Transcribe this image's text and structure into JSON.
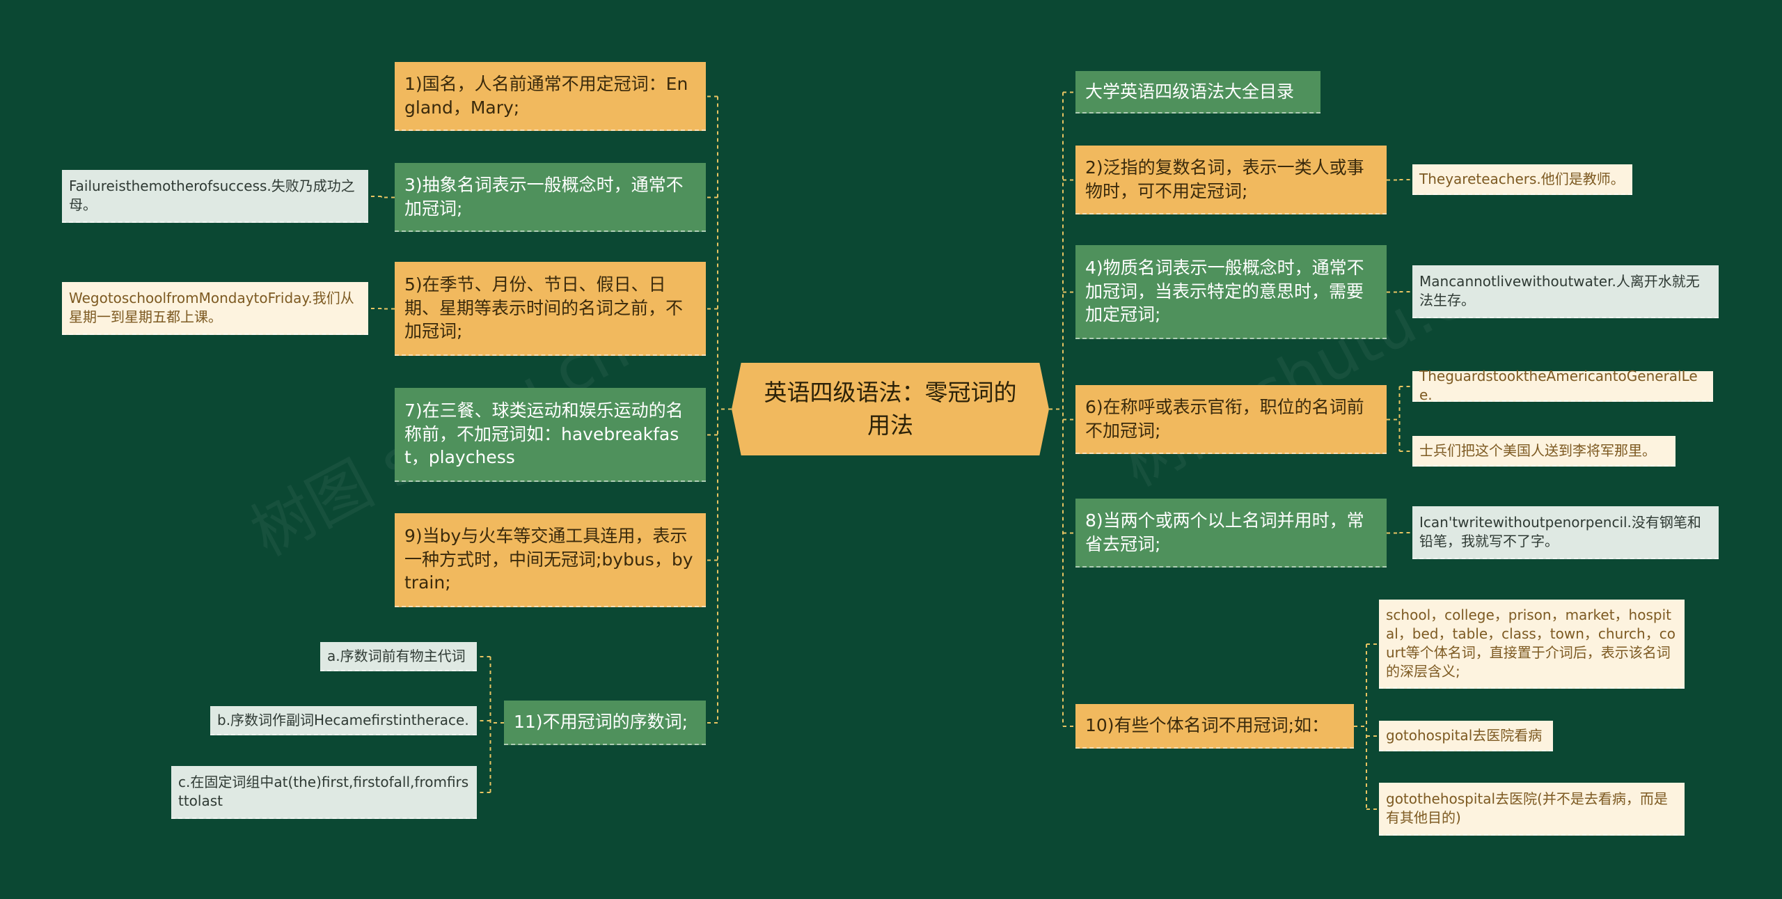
{
  "root": {
    "label": "英语四级语法：零冠词的用法"
  },
  "left_branches": [
    {
      "id": "l1",
      "label": "1)国名，人名前通常不用定冠词：England，Mary;",
      "color": "orange",
      "children": []
    },
    {
      "id": "l3",
      "label": "3)抽象名词表示一般概念时，通常不加冠词;",
      "color": "green",
      "children": [
        {
          "id": "l3a",
          "label": "Failureisthemotherofsuccess.失败乃成功之母。",
          "color": "mint"
        }
      ]
    },
    {
      "id": "l5",
      "label": "5)在季节、月份、节日、假日、日期、星期等表示时间的名词之前，不加冠词;",
      "color": "orange",
      "children": [
        {
          "id": "l5a",
          "label": "WegotoschoolfromMondaytoFriday.我们从星期一到星期五都上课。",
          "color": "cream"
        }
      ]
    },
    {
      "id": "l7",
      "label": "7)在三餐、球类运动和娱乐运动的名称前，不加冠词如：havebreakfast，playchess",
      "color": "green",
      "children": []
    },
    {
      "id": "l9",
      "label": "9)当by与火车等交通工具连用，表示一种方式时，中间无冠词;bybus，bytrain;",
      "color": "orange",
      "children": []
    },
    {
      "id": "l11",
      "label": "11)不用冠词的序数词;",
      "color": "green",
      "children": [
        {
          "id": "l11a",
          "label": "a.序数词前有物主代词",
          "color": "mint"
        },
        {
          "id": "l11b",
          "label": "b.序数词作副词Hecamefirstintherace.",
          "color": "mint"
        },
        {
          "id": "l11c",
          "label": "c.在固定词组中at(the)first,firstofall,fromfirsttolast",
          "color": "mint"
        }
      ]
    }
  ],
  "right_branches": [
    {
      "id": "r0",
      "label": "大学英语四级语法大全目录",
      "color": "green",
      "children": []
    },
    {
      "id": "r2",
      "label": "2)泛指的复数名词，表示一类人或事物时，可不用定冠词;",
      "color": "orange",
      "children": [
        {
          "id": "r2a",
          "label": "Theyareteachers.他们是教师。",
          "color": "cream"
        }
      ]
    },
    {
      "id": "r4",
      "label": "4)物质名词表示一般概念时，通常不加冠词，当表示特定的意思时，需要加定冠词;",
      "color": "green",
      "children": [
        {
          "id": "r4a",
          "label": "Mancannotlivewithoutwater.人离开水就无法生存。",
          "color": "mint"
        }
      ]
    },
    {
      "id": "r6",
      "label": "6)在称呼或表示官衔，职位的名词前不加冠词;",
      "color": "orange",
      "children": [
        {
          "id": "r6a",
          "label": "TheguardstooktheAmericantoGeneralLee.",
          "color": "cream"
        },
        {
          "id": "r6b",
          "label": "士兵们把这个美国人送到李将军那里。",
          "color": "cream"
        }
      ]
    },
    {
      "id": "r8",
      "label": "8)当两个或两个以上名词并用时，常省去冠词;",
      "color": "green",
      "children": [
        {
          "id": "r8a",
          "label": "Ican'twritewithoutpenorpencil.没有钢笔和铅笔，我就写不了字。",
          "color": "mint"
        }
      ]
    },
    {
      "id": "r10",
      "label": "10)有些个体名词不用冠词;如：",
      "color": "orange",
      "children": [
        {
          "id": "r10a",
          "label": "school，college，prison，market，hospital，bed，table，class，town，church，court等个体名词，直接置于介词后，表示该名词的深层含义;",
          "color": "cream"
        },
        {
          "id": "r10b",
          "label": "gotohospital去医院看病",
          "color": "cream"
        },
        {
          "id": "r10c",
          "label": "gotothehospital去医院(并不是去看病，而是有其他目的)",
          "color": "cream"
        }
      ]
    }
  ],
  "colors": {
    "background": "#0b4833",
    "orange": "#f1b95e",
    "green": "#4f915c",
    "mint": "#dfe9e3",
    "cream": "#fdf3df",
    "connector": "#e8c463"
  }
}
